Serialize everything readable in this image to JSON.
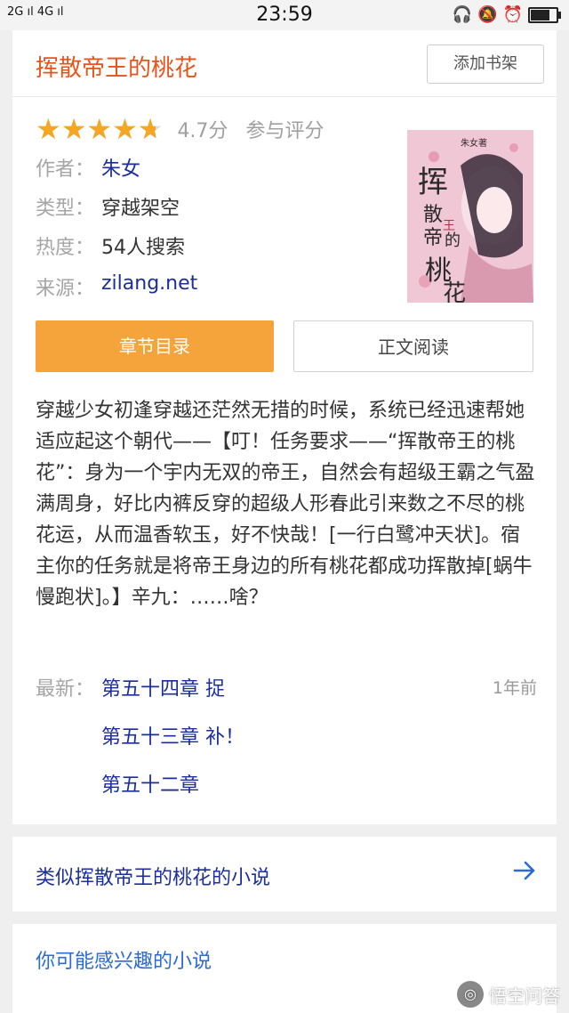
{
  "statusbar": {
    "signal": "2G ıl 4G ıl",
    "time": "23:59"
  },
  "book": {
    "title": "挥散帝王的桃花",
    "add_shelf_label": "添加书架",
    "stars": "★★★★★",
    "rating_fraction": 0.94,
    "score": "4.7分",
    "rate_label": "参与评分",
    "author_key": "作者：",
    "author": "朱女",
    "type_key": "类型：",
    "type": "穿越架空",
    "heat_key": "热度：",
    "heat": "54人搜索",
    "source_key": "来源：",
    "source": "zilang.net",
    "cover_title_chars": "挥散帝王的桃花",
    "cover_author": "朱女著",
    "toc_label": "章节目录",
    "read_label": "正文阅读",
    "description": "穿越少女初逢穿越还茫然无措的时候，系统已经迅速帮她适应起这个朝代——【叮！任务要求——“挥散帝王的桃花”：身为一个宇内无双的帝王，自然会有超级王霸之气盈满周身，好比内裤反穿的超级人形春此引来数之不尽的桃花运，从而温香软玉，好不快哉！[一行白鹭冲天状]。宿主你的任务就是将帝王身边的所有桃花都成功挥散掉[蜗牛慢跑状]。】辛九：……啥？",
    "latest_label": "最新：",
    "chapters": [
      "第五十四章 捉",
      "第五十三章 补！",
      "第五十二章"
    ],
    "latest_time": "1年前"
  },
  "similar": {
    "label": "类似挥散帝王的桃花的小说"
  },
  "interest": {
    "label": "你可能感兴趣的小说"
  },
  "watermark": {
    "text": "悟空问答"
  },
  "colors": {
    "title": "#e8531a",
    "star": "#f5a623",
    "toc_button": "#f5a33b",
    "link": "#1b2e9c"
  }
}
